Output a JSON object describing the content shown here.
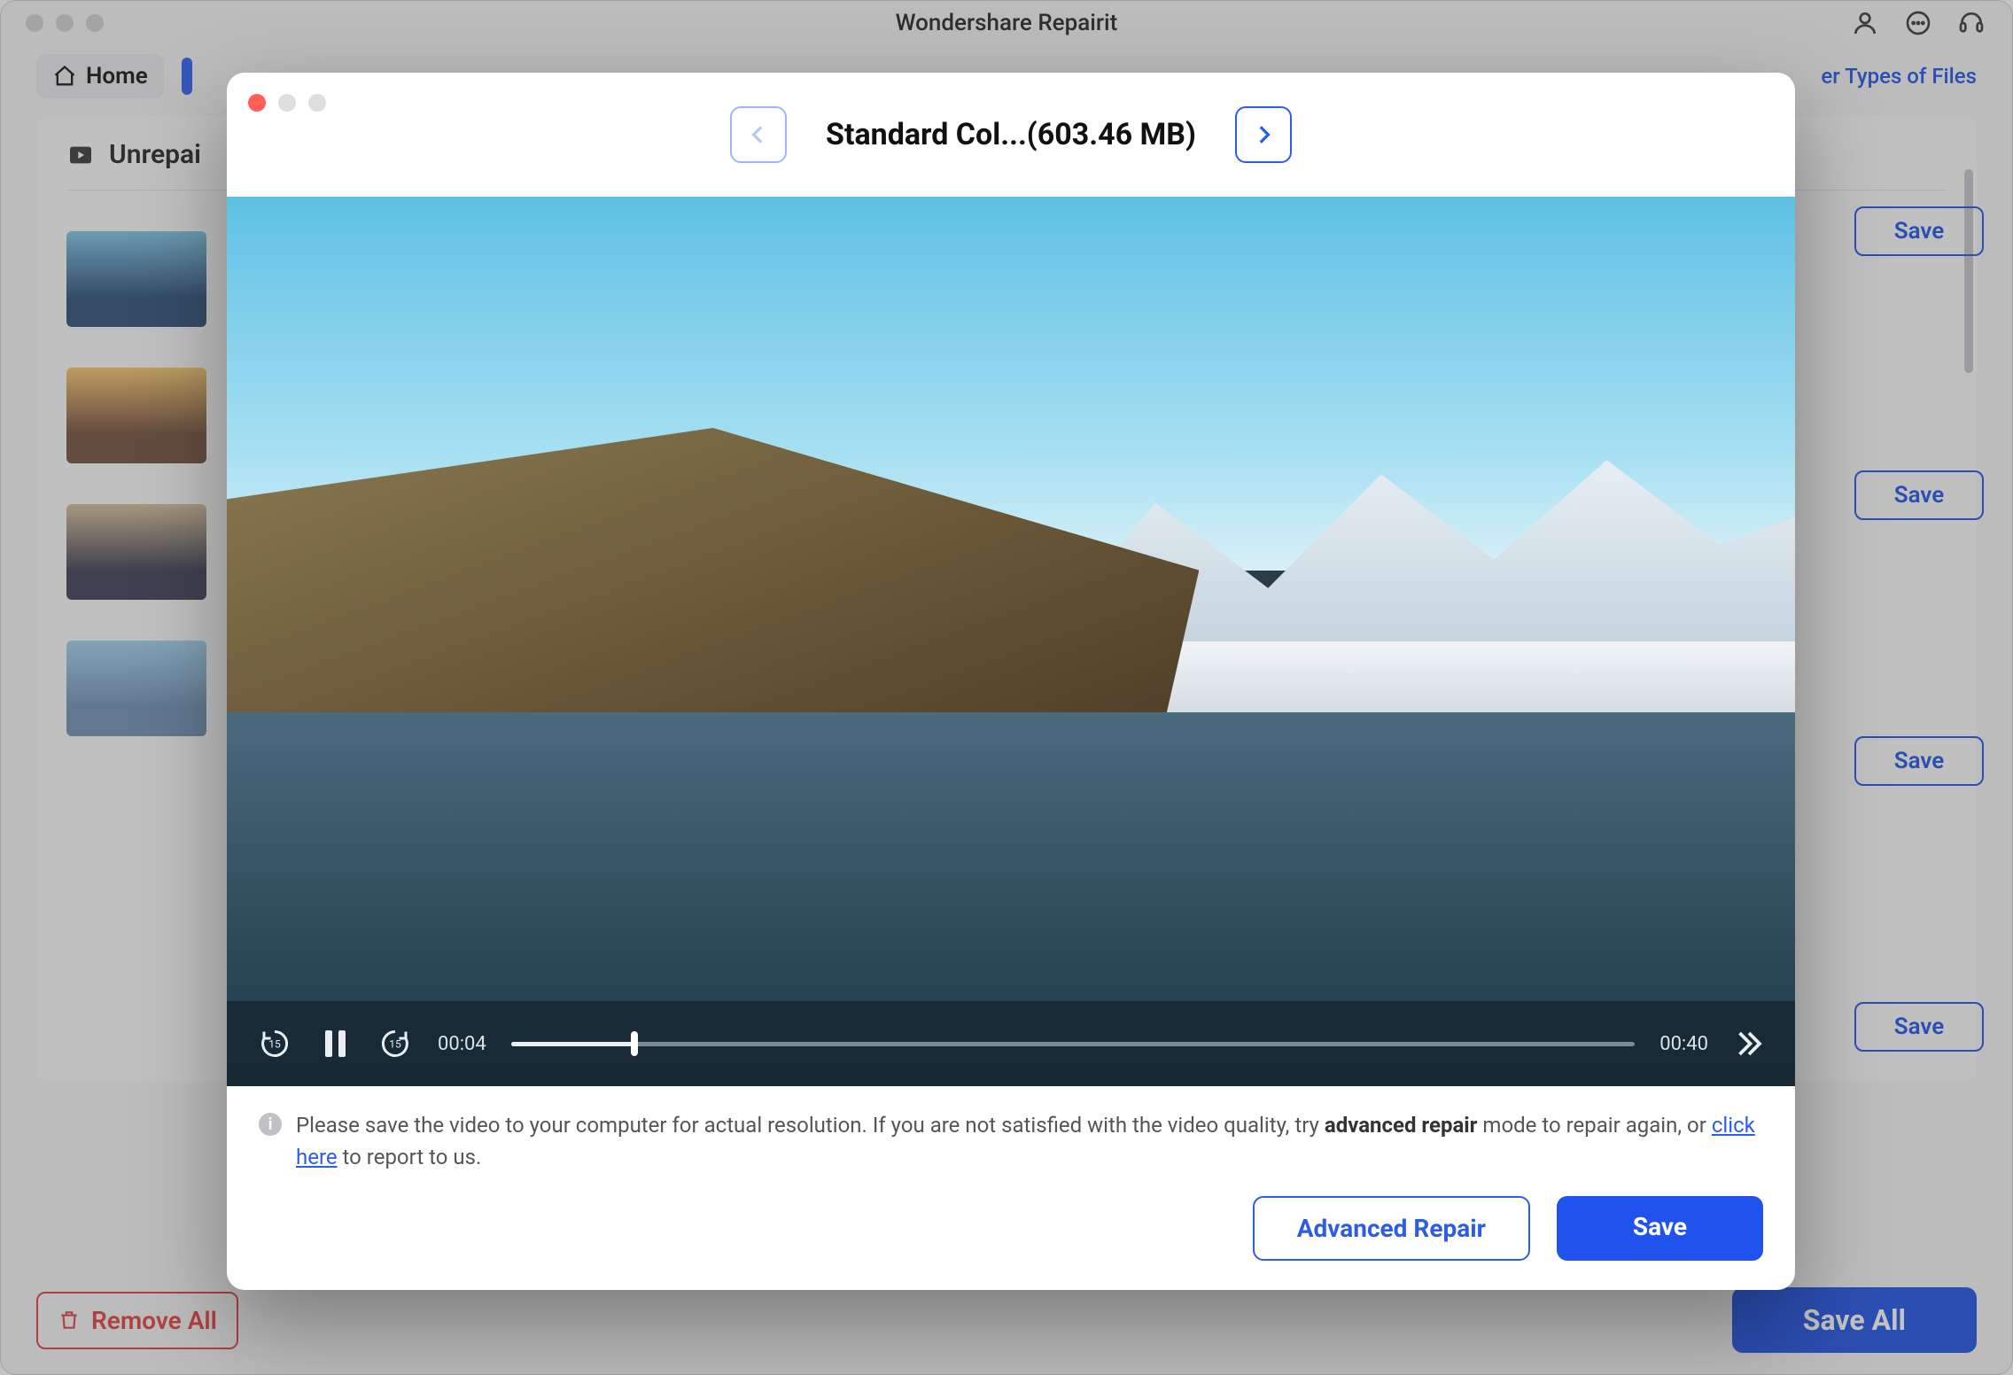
{
  "app_title": "Wondershare Repairit",
  "toolbar": {
    "home": "Home",
    "other_types": "er Types of Files"
  },
  "section": {
    "title": "Unrepai"
  },
  "list": {
    "save_label": "Save"
  },
  "bottom": {
    "remove_all": "Remove All",
    "save_all": "Save All"
  },
  "modal": {
    "title": "Standard Col...(603.46 MB)",
    "playback": {
      "current": "00:04",
      "total": "00:40",
      "progress_pct": 11
    },
    "hint_pre": "Please save the video to your computer for actual resolution. If you are not satisfied with the video quality, try ",
    "hint_bold": "advanced repair",
    "hint_mid": " mode to repair again, or ",
    "hint_link": "click here",
    "hint_post": " to report to us.",
    "advanced_repair": "Advanced Repair",
    "save": "Save"
  }
}
